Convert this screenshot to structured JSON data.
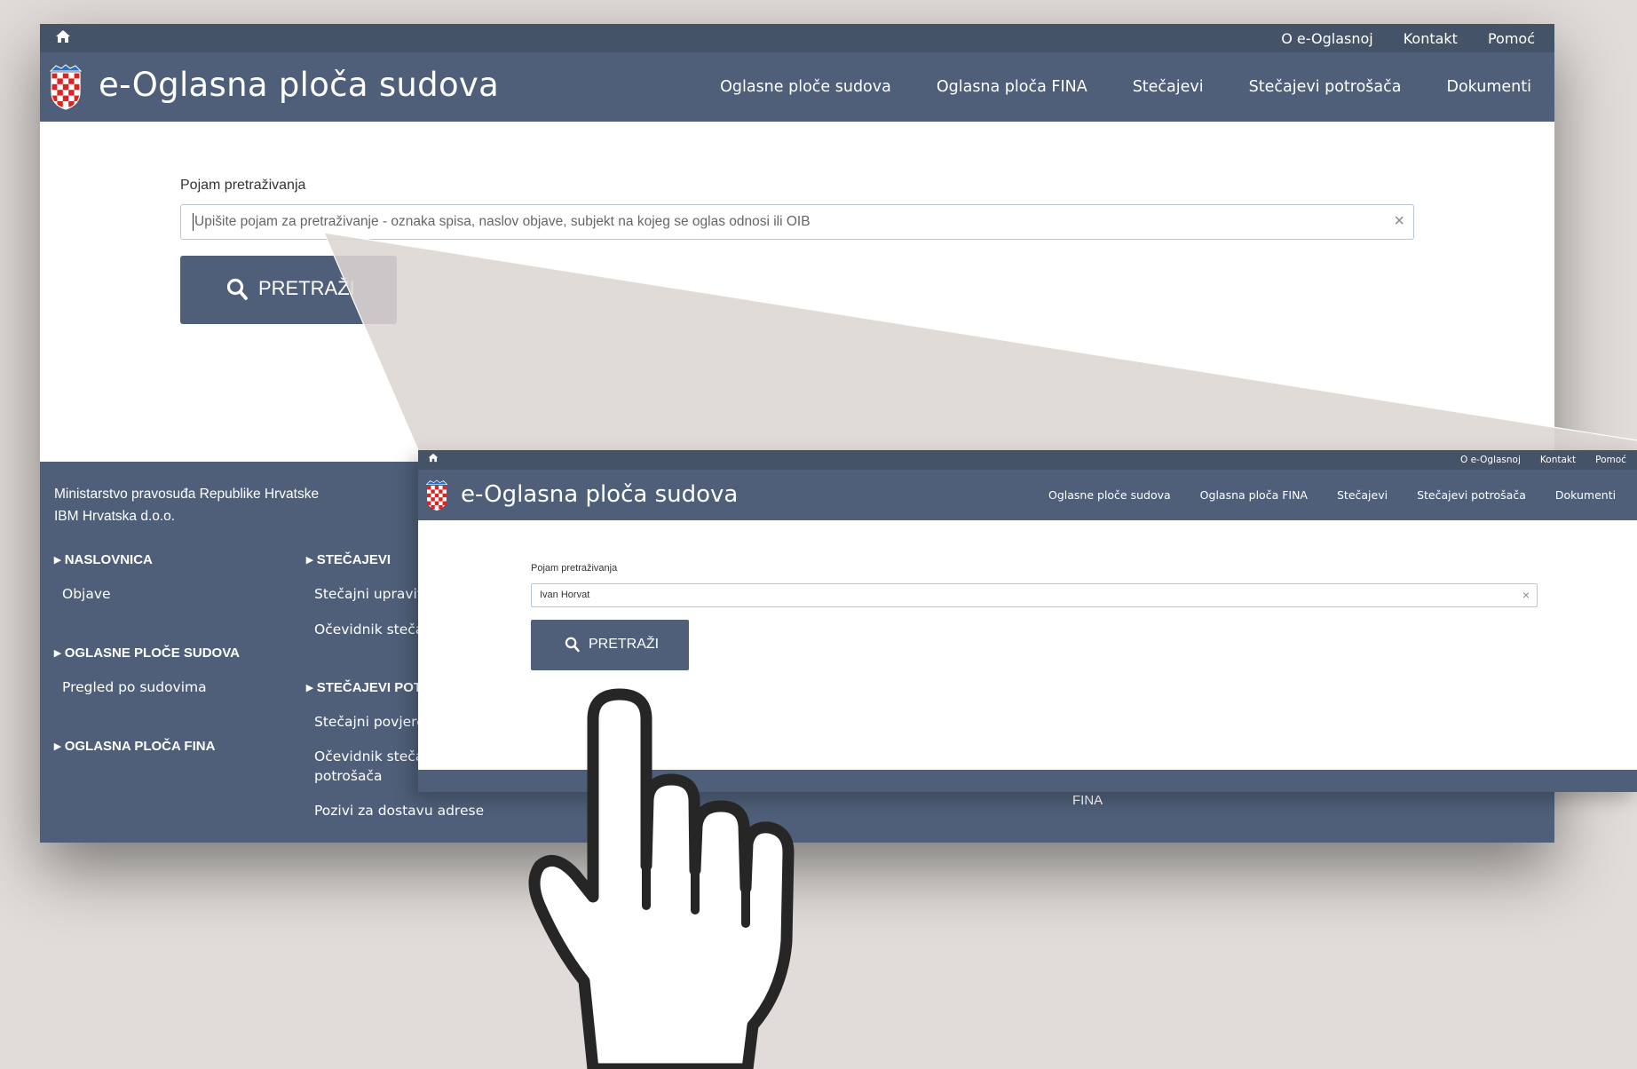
{
  "main_window": {
    "top_links": [
      "O e-Oglasnoj",
      "Kontakt",
      "Pomoć"
    ],
    "brand": "e-Oglasna ploča sudova",
    "nav_links": [
      "Oglasne ploče sudova",
      "Oglasna ploča FINA",
      "Stečajevi",
      "Stečajevi potrošača",
      "Dokumenti"
    ],
    "search": {
      "label": "Pojam pretraživanja",
      "placeholder": "Upišite pojam za pretraživanje - oznaka spisa, naslov objave, subjekt na kojeg se oglas odnosi ili OIB",
      "clear": "×",
      "button": "PRETRAŽI"
    },
    "footer": {
      "org1": "Ministarstvo pravosuđa Republike Hrvatske",
      "org2": "IBM Hrvatska d.o.o.",
      "col1": {
        "h1": "NASLOVNICA",
        "h1_items": [
          "Objave"
        ],
        "h2": "OGLASNE PLOČE SUDOVA",
        "h2_items": [
          "Pregled po sudovima"
        ],
        "h3": "OGLASNA PLOČA FINA"
      },
      "col2": {
        "h1": "STEČAJEVI",
        "h1_items": [
          "Stečajni upravit",
          "Očevidnik steča"
        ],
        "h2": "STEČAJEVI POTR",
        "h2_items": [
          "Stečajni povjere",
          "Očevidnik steča",
          "potrošača",
          "Pozivi za dostavu adrese"
        ]
      },
      "fina": "FINA"
    }
  },
  "zoom_window": {
    "top_links": [
      "O e-Oglasnoj",
      "Kontakt",
      "Pomoć"
    ],
    "brand": "e-Oglasna ploča sudova",
    "nav_links": [
      "Oglasne ploče sudova",
      "Oglasna ploča FINA",
      "Stečajevi",
      "Stečajevi potrošača",
      "Dokumenti"
    ],
    "search": {
      "label": "Pojam pretraživanja",
      "value": "Ivan Horvat",
      "clear": "×",
      "button": "PRETRAŽI"
    }
  },
  "colors": {
    "topbar": "#455368",
    "navbar": "#4f5f79",
    "background": "#e1dcd9",
    "input_border": "#b6c7d8"
  },
  "icons": [
    "home-icon",
    "coat-of-arms-logo",
    "search-icon",
    "close-icon",
    "pointing-hand-icon"
  ]
}
